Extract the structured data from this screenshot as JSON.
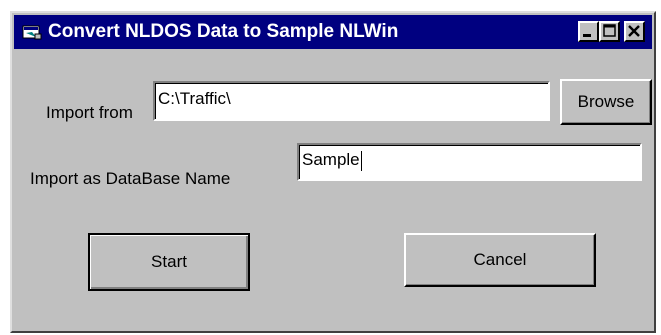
{
  "window": {
    "title": "Convert NLDOS Data to Sample NLWin",
    "icons": {
      "app": "app-window-icon",
      "minimize": "minimize-icon",
      "maximize": "maximize-icon",
      "close": "close-icon"
    },
    "colors": {
      "titlebar": "#000080",
      "face": "#c0c0c0"
    }
  },
  "form": {
    "import_from_label": "Import from",
    "import_from_value": "C:\\Traffic\\",
    "import_as_label": "Import as DataBase Name",
    "import_as_value": "Sample"
  },
  "buttons": {
    "browse": "Browse",
    "start": "Start",
    "cancel": "Cancel"
  }
}
